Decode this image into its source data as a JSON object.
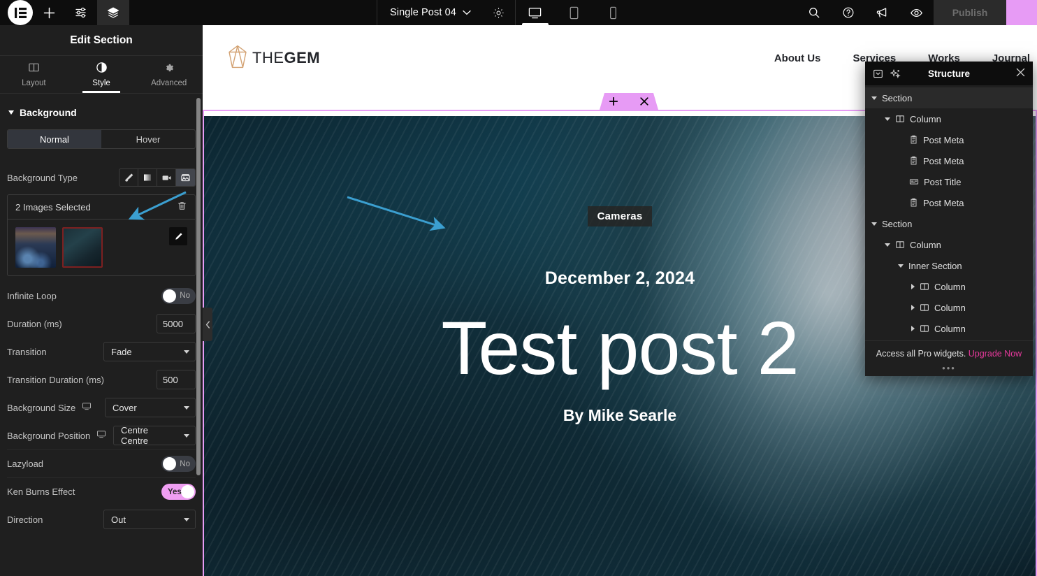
{
  "topbar": {
    "logo_icon": "elementor-logo-icon",
    "add_icon": "plus-icon",
    "settings_icon": "sliders-icon",
    "layers_icon": "layers-icon",
    "document_name": "Single Post 04",
    "chevron_icon": "chevron-down-icon",
    "doc_settings_icon": "gear-icon",
    "responsive": [
      {
        "name": "desktop",
        "icon": "desktop-icon",
        "active": true
      },
      {
        "name": "tablet",
        "icon": "tablet-icon",
        "active": false
      },
      {
        "name": "mobile",
        "icon": "mobile-icon",
        "active": false
      }
    ],
    "right_icons": [
      {
        "name": "search-icon"
      },
      {
        "name": "help-icon"
      },
      {
        "name": "whats-new-icon"
      },
      {
        "name": "preview-icon"
      }
    ],
    "publish_label": "Publish"
  },
  "panel": {
    "header_title": "Edit Section",
    "tabs": [
      {
        "label": "Layout",
        "icon": "layout-icon",
        "active": false
      },
      {
        "label": "Style",
        "icon": "style-icon",
        "active": true
      },
      {
        "label": "Advanced",
        "icon": "advanced-gear-icon",
        "active": false
      }
    ],
    "section_title": "Background",
    "state_tabs": [
      {
        "label": "Normal",
        "active": true
      },
      {
        "label": "Hover",
        "active": false
      }
    ],
    "background_type": {
      "label": "Background Type",
      "options": [
        {
          "name": "classic-brush-icon",
          "active": false
        },
        {
          "name": "gradient-icon",
          "active": false
        },
        {
          "name": "video-icon",
          "active": false
        },
        {
          "name": "slideshow-icon",
          "active": true
        }
      ]
    },
    "gallery": {
      "title": "2 Images Selected",
      "delete_icon": "trash-icon",
      "edit_icon": "pencil-icon",
      "thumbs": [
        {
          "name": "gallery-thumb-1",
          "selected": false
        },
        {
          "name": "gallery-thumb-2",
          "selected": true
        }
      ]
    },
    "controls": [
      {
        "label": "Infinite Loop",
        "type": "toggle",
        "value": "No",
        "on": false
      },
      {
        "label": "Duration (ms)",
        "type": "number",
        "value": "5000"
      },
      {
        "label": "Transition",
        "type": "select",
        "value": "Fade"
      },
      {
        "label": "Transition Duration (ms)",
        "type": "number",
        "value": "500"
      },
      {
        "label": "Background Size",
        "type": "select",
        "value": "Cover",
        "device_icon": "desktop-icon"
      },
      {
        "label": "Background Position",
        "type": "select",
        "value": "Centre Centre",
        "device_icon": "desktop-icon"
      },
      {
        "label": "Lazyload",
        "type": "toggle",
        "value": "No",
        "on": false
      },
      {
        "label": "Ken Burns Effect",
        "type": "toggle",
        "value": "Yes",
        "on": true
      },
      {
        "label": "Direction",
        "type": "select",
        "value": "Out"
      }
    ],
    "collapse_icon": "chevron-left-icon"
  },
  "site": {
    "logo_text_light": "THE",
    "logo_text_bold": "GEM",
    "nav": [
      {
        "label": "About Us"
      },
      {
        "label": "Services"
      },
      {
        "label": "Works"
      },
      {
        "label": "Journal"
      }
    ],
    "hero": {
      "category": "Cameras",
      "date": "December 2, 2024",
      "title": "Test post 2",
      "author": "By Mike Searle"
    },
    "section_handle": {
      "add_icon": "plus-icon",
      "drag_icon": "drag-dots-icon",
      "close_icon": "close-icon"
    }
  },
  "navigator": {
    "title": "Structure",
    "minimize_icon": "minimize-icon",
    "ai_icon": "sparkle-icon",
    "close_icon": "close-icon",
    "tree": [
      {
        "label": "Section",
        "depth": 0,
        "icon": null,
        "arrow": "down",
        "highlight": true
      },
      {
        "label": "Column",
        "depth": 1,
        "icon": "column-icon",
        "arrow": "down"
      },
      {
        "label": "Post Meta",
        "depth": 2,
        "icon": "post-meta-icon",
        "arrow": null
      },
      {
        "label": "Post Meta",
        "depth": 2,
        "icon": "post-meta-icon",
        "arrow": null
      },
      {
        "label": "Post Title",
        "depth": 2,
        "icon": "post-title-icon",
        "arrow": null
      },
      {
        "label": "Post Meta",
        "depth": 2,
        "icon": "post-meta-icon",
        "arrow": null
      },
      {
        "label": "Section",
        "depth": 0,
        "icon": null,
        "arrow": "down"
      },
      {
        "label": "Column",
        "depth": 1,
        "icon": "column-icon",
        "arrow": "down"
      },
      {
        "label": "Inner Section",
        "depth": 2,
        "icon": null,
        "arrow": "down"
      },
      {
        "label": "Column",
        "depth": 3,
        "icon": "column-icon",
        "arrow": "right"
      },
      {
        "label": "Column",
        "depth": 3,
        "icon": "column-icon",
        "arrow": "right"
      },
      {
        "label": "Column",
        "depth": 3,
        "icon": "column-icon",
        "arrow": "right"
      }
    ],
    "footer_text": "Access all Pro widgets.",
    "footer_link": "Upgrade Now",
    "footer_dots": "•••"
  },
  "colors": {
    "accent_pink": "#e79bf5",
    "link_pink": "#e5399b",
    "panel_bg": "#1f1f1f",
    "topbar_bg": "#0d0d0d",
    "annotation_blue": "#3b9fd0"
  }
}
